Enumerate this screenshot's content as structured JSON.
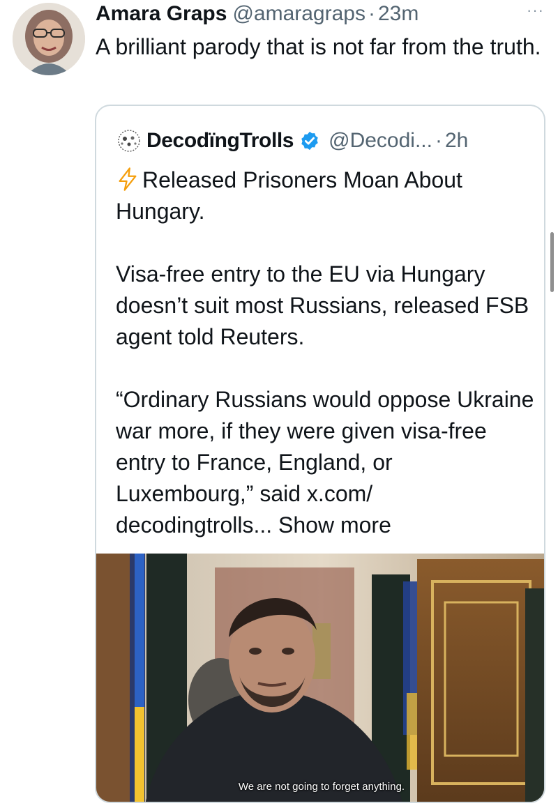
{
  "tweet": {
    "author_name": "Amara Graps",
    "author_handle": "@amaragraps",
    "separator": "·",
    "time": "23m",
    "more_label": "···",
    "text": "A brilliant parody that is not far from the truth."
  },
  "quote": {
    "author_name": "DecodïngTrolls",
    "author_handle": "@Decodi...",
    "separator": "·",
    "time": "2h",
    "title": "Released Prisoners Moan About Hungary.",
    "paragraph_1": "Visa-free entry to the EU via Hungary doesn’t suit most Russians, released FSB agent told Reuters.",
    "paragraph_2": "“Ordinary Russians would oppose Ukraine war more, if they were given visa-free entry to France, England, or Luxembourg,” said x.com/ decodingtrolls...",
    "show_more": "Show more",
    "video_caption": "We are not going to forget anything."
  },
  "icons": {
    "bolt": "lightning-bolt-icon",
    "verified": "verified-badge-icon",
    "more": "more-options-icon"
  },
  "colors": {
    "text_primary": "#0f1419",
    "text_secondary": "#536471",
    "verified_blue": "#1d9bf0",
    "bolt_orange": "#f59e0b",
    "card_border": "#cfd9de"
  }
}
